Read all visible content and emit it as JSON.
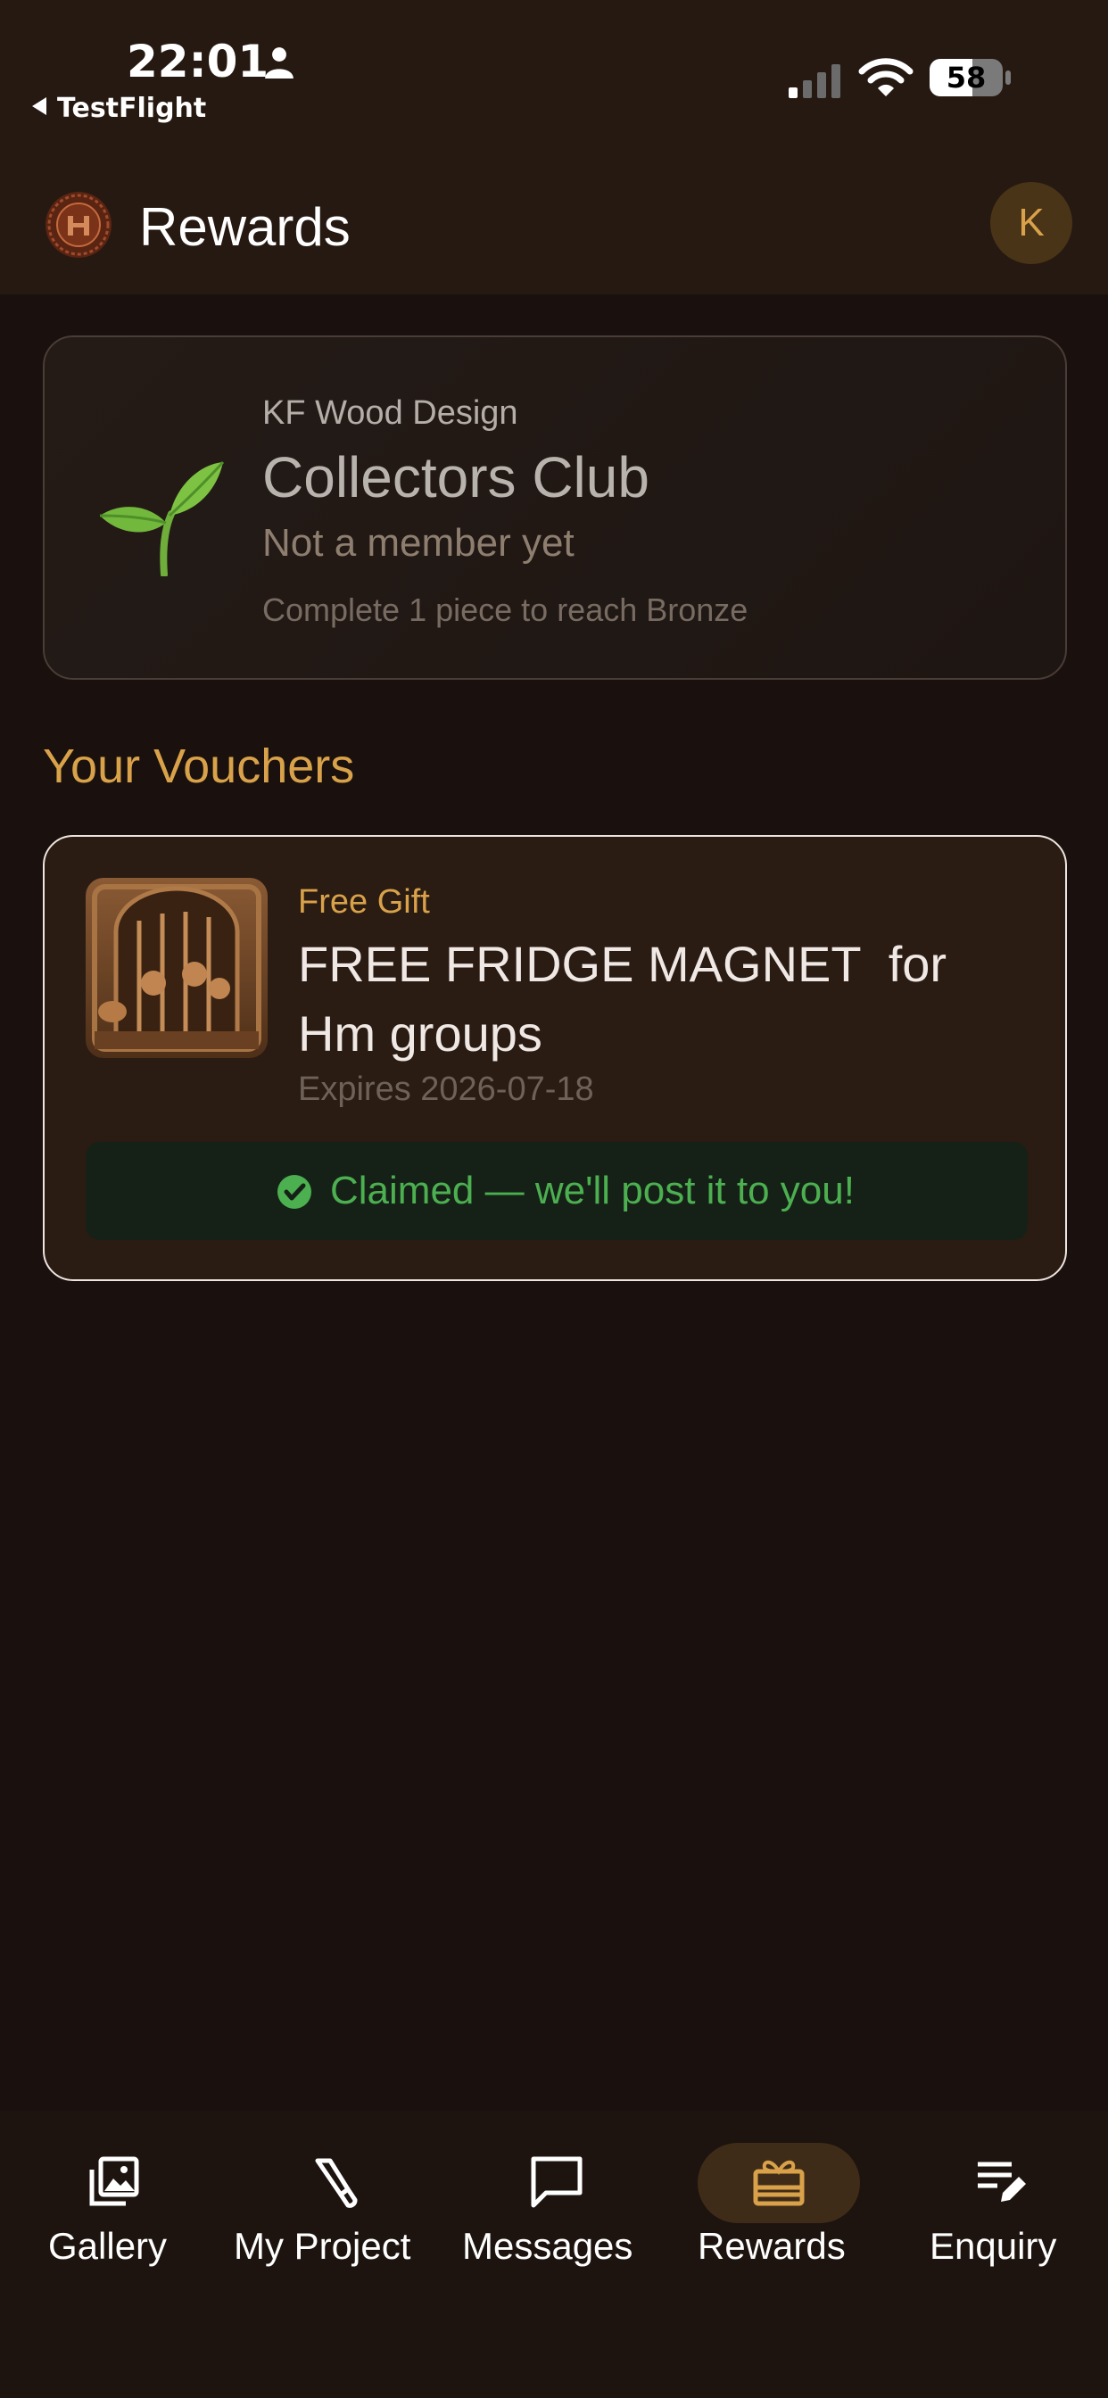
{
  "status_bar": {
    "time": "22:01",
    "back_app": "TestFlight",
    "battery": "58"
  },
  "header": {
    "title": "Rewards",
    "avatar_initial": "K"
  },
  "club_card": {
    "brand": "KF Wood Design",
    "title": "Collectors Club",
    "status": "Not a member yet",
    "progress": "Complete 1 piece to reach Bronze",
    "icon": "sprout-icon"
  },
  "vouchers_section": {
    "title": "Your Vouchers",
    "items": [
      {
        "type": "Free Gift",
        "title": "FREE FRIDGE MAGNET  for\nHm groups",
        "expiry": "Expires 2026-07-18",
        "status": "Claimed — we'll post it to you!"
      }
    ]
  },
  "tab_bar": {
    "active": "Rewards",
    "tabs": [
      {
        "label": "Gallery",
        "icon": "gallery-icon"
      },
      {
        "label": "My Project",
        "icon": "tool-icon"
      },
      {
        "label": "Messages",
        "icon": "message-icon"
      },
      {
        "label": "Rewards",
        "icon": "gift-icon"
      },
      {
        "label": "Enquiry",
        "icon": "edit-list-icon"
      }
    ]
  },
  "colors": {
    "background": "#1a110e",
    "header": "#261911",
    "accent": "#d9a24a",
    "success": "#4caf50",
    "card": "#2a1b13"
  }
}
